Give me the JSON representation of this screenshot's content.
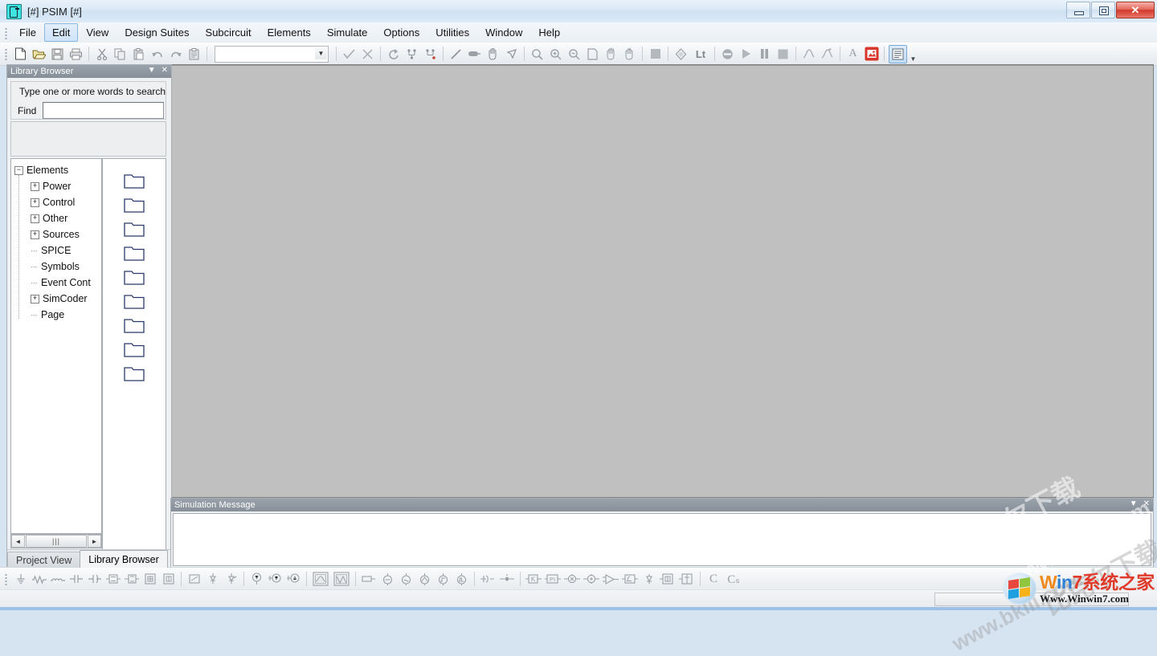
{
  "window": {
    "title": "[#] PSIM [#]",
    "icon": "psim-app-icon",
    "controls": {
      "minimize": "Minimize",
      "restore": "Restore",
      "close": "Close"
    }
  },
  "menubar": {
    "items": [
      {
        "label": "File",
        "active": false
      },
      {
        "label": "Edit",
        "active": true
      },
      {
        "label": "View",
        "active": false
      },
      {
        "label": "Design Suites",
        "active": false
      },
      {
        "label": "Subcircuit",
        "active": false
      },
      {
        "label": "Elements",
        "active": false
      },
      {
        "label": "Simulate",
        "active": false
      },
      {
        "label": "Options",
        "active": false
      },
      {
        "label": "Utilities",
        "active": false
      },
      {
        "label": "Window",
        "active": false
      },
      {
        "label": "Help",
        "active": false
      }
    ]
  },
  "toolbar": {
    "combo_value": "",
    "buttons": [
      {
        "icon": "new-file-icon",
        "title": "New"
      },
      {
        "icon": "open-folder-icon",
        "title": "Open"
      },
      {
        "icon": "save-disk-icon",
        "title": "Save"
      },
      {
        "icon": "print-icon",
        "title": "Print"
      },
      {
        "icon": "cut-scissors-icon",
        "title": "Cut"
      },
      {
        "icon": "copy-icon",
        "title": "Copy"
      },
      {
        "icon": "paste-icon",
        "title": "Paste"
      },
      {
        "icon": "undo-icon",
        "title": "Undo"
      },
      {
        "icon": "redo-icon",
        "title": "Redo"
      },
      {
        "icon": "clipboard-icon",
        "title": "Paste Special"
      },
      {
        "icon": "check-icon",
        "title": "Accept"
      },
      {
        "icon": "cross-icon",
        "title": "Reject"
      },
      {
        "icon": "refresh-arrow-icon",
        "title": "Refresh"
      },
      {
        "icon": "netlist-icon",
        "title": "Netlist"
      },
      {
        "icon": "netlist-run-icon",
        "title": "Generate Netlist"
      },
      {
        "icon": "wire-line-icon",
        "title": "Wire"
      },
      {
        "icon": "label-icon",
        "title": "Label"
      },
      {
        "icon": "hand-pan-icon",
        "title": "Pan"
      },
      {
        "icon": "select-arrow-icon",
        "title": "Select"
      },
      {
        "icon": "zoom-icon",
        "title": "Zoom"
      },
      {
        "icon": "zoom-in-icon",
        "title": "Zoom In"
      },
      {
        "icon": "zoom-out-icon",
        "title": "Zoom Out"
      },
      {
        "icon": "fit-page-icon",
        "title": "Fit to Page"
      },
      {
        "icon": "zoom-region-icon",
        "title": "Zoom Region"
      },
      {
        "icon": "zoom-previous-icon",
        "title": "Previous Zoom"
      },
      {
        "icon": "stop-square-icon",
        "title": "Stop"
      },
      {
        "icon": "diamond-icon",
        "title": "Parameter"
      },
      {
        "icon": "lt-text-icon",
        "title": "Lt"
      },
      {
        "icon": "no-entry-icon",
        "title": "Disable"
      },
      {
        "icon": "run-play-icon",
        "title": "Run Simulation"
      },
      {
        "icon": "pause-icon",
        "title": "Pause"
      },
      {
        "icon": "stop-icon",
        "title": "Stop Simulation"
      },
      {
        "icon": "waveform-icon",
        "title": "Waveform"
      },
      {
        "icon": "waveform-add-icon",
        "title": "Add Waveform"
      },
      {
        "icon": "text-a-icon",
        "title": "Text"
      },
      {
        "icon": "red-image-icon",
        "title": "Image"
      },
      {
        "icon": "list-view-icon",
        "title": "List View"
      }
    ],
    "toolbar_pressed_index": 36,
    "overflow": "More"
  },
  "library_browser": {
    "dock_title": "Library Browser",
    "dock_controls": {
      "menu": "Panel Menu",
      "close": "Close"
    },
    "search_hint": "Type one or more words to search in e",
    "find_label": "Find",
    "find_value": "",
    "find_placeholder": "",
    "tree": [
      {
        "label": "Elements",
        "depth": 0,
        "state": "expanded"
      },
      {
        "label": "Power",
        "depth": 1,
        "state": "collapsed"
      },
      {
        "label": "Control",
        "depth": 1,
        "state": "collapsed"
      },
      {
        "label": "Other",
        "depth": 1,
        "state": "collapsed"
      },
      {
        "label": "Sources",
        "depth": 1,
        "state": "collapsed"
      },
      {
        "label": "SPICE",
        "depth": 1,
        "state": "leaf"
      },
      {
        "label": "Symbols",
        "depth": 1,
        "state": "leaf"
      },
      {
        "label": "Event Cont",
        "depth": 1,
        "state": "leaf"
      },
      {
        "label": "SimCoder",
        "depth": 1,
        "state": "collapsed"
      },
      {
        "label": "Page",
        "depth": 1,
        "state": "leaf"
      }
    ],
    "folder_count": 9,
    "folder_icon": "folder-icon",
    "hscroll": {
      "left": "◄",
      "right": "►",
      "thumb": "|||"
    },
    "tabs": [
      {
        "label": "Project View",
        "active": false
      },
      {
        "label": "Library Browser",
        "active": true
      }
    ]
  },
  "simulation_message": {
    "dock_title": "Simulation Message",
    "dock_controls": {
      "menu": "Panel Menu",
      "close": "Close"
    },
    "content": ""
  },
  "canvas": {
    "background_color": "#c0c0c0",
    "content": ""
  },
  "elements_toolbar": {
    "groups": [
      {
        "items": [
          {
            "icon": "ground-icon"
          },
          {
            "icon": "resistor-icon"
          },
          {
            "icon": "inductor-icon"
          },
          {
            "icon": "capacitor-icon"
          },
          {
            "icon": "capacitor-polarized-icon"
          },
          {
            "icon": "rl-block-icon"
          },
          {
            "icon": "rlc-block-icon"
          },
          {
            "icon": "transformer-box-icon"
          },
          {
            "icon": "transformer-box2-icon"
          }
        ]
      },
      {
        "items": [
          {
            "icon": "switch-box-icon"
          },
          {
            "icon": "diode-icon"
          },
          {
            "icon": "thyristor-icon"
          }
        ]
      },
      {
        "items": [
          {
            "icon": "voltmeter-icon"
          },
          {
            "icon": "voltage-probe-icon"
          },
          {
            "icon": "ammeter-icon"
          }
        ]
      },
      {
        "items": [
          {
            "icon": "scope-icon"
          },
          {
            "icon": "scope2-icon"
          }
        ]
      },
      {
        "items": [
          {
            "icon": "dc-source-icon"
          },
          {
            "icon": "sine-source-icon"
          },
          {
            "icon": "ac-source-icon"
          },
          {
            "icon": "triangle-source-icon"
          },
          {
            "icon": "step-source-icon"
          },
          {
            "icon": "square-source-icon"
          }
        ]
      },
      {
        "items": [
          {
            "icon": "gate-block-icon"
          },
          {
            "icon": "gating-block-icon"
          }
        ]
      },
      {
        "items": [
          {
            "icon": "gain-k-icon"
          },
          {
            "icon": "pi-block-icon"
          },
          {
            "icon": "sum-block-icon"
          },
          {
            "icon": "sum2-block-icon"
          },
          {
            "icon": "comparator-icon"
          },
          {
            "icon": "integrator-icon"
          },
          {
            "icon": "limiter-icon"
          },
          {
            "icon": "transfer-block-icon"
          },
          {
            "icon": "math-block-icon"
          }
        ]
      },
      {
        "items": [
          {
            "icon": "c-block-icon",
            "label": "C"
          },
          {
            "icon": "cs-block-icon",
            "label": "Cₛ"
          }
        ]
      }
    ]
  },
  "statusbar": {
    "message": "",
    "pane": ""
  },
  "watermarks": {
    "canvas_primary": "比克尔下载",
    "canvas_secondary": "www.bkill.com",
    "site_logo": {
      "line1_parts": [
        "W",
        "i",
        "n",
        "7",
        "系统之家"
      ],
      "line2": "Www.Winwin7.com"
    }
  },
  "colors": {
    "titlebar": "#d9e8f6",
    "canvas": "#c0c0c0",
    "dock_header": "#8e979f",
    "accent_blue": "#8ab7e0",
    "close_red": "#d2392b"
  }
}
